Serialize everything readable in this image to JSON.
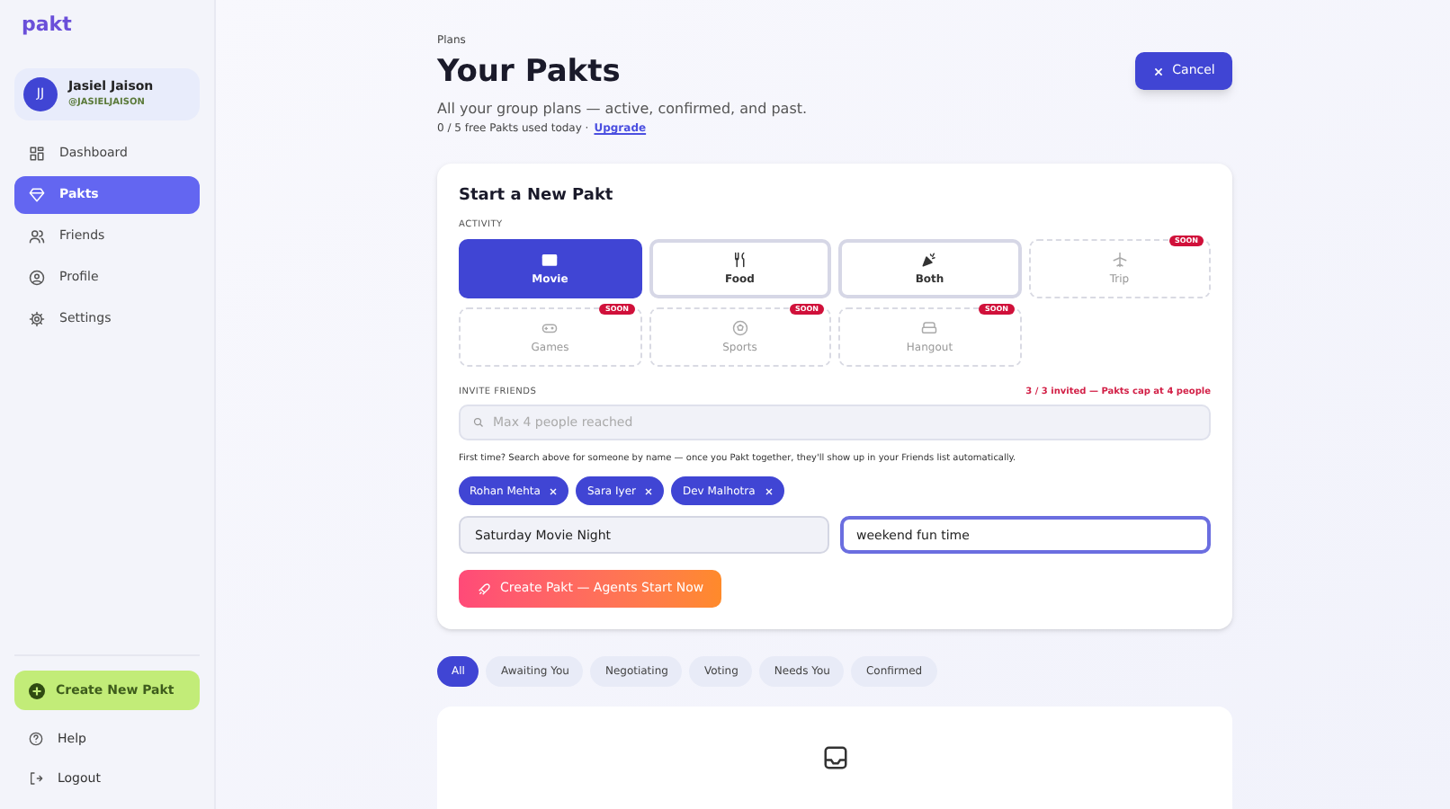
{
  "sidebar": {
    "logo": "pakt",
    "user": {
      "initials": "JJ",
      "name": "Jasiel Jaison",
      "handle": "@JASIELJAISON"
    },
    "items": [
      {
        "label": "Dashboard",
        "selected": false
      },
      {
        "label": "Pakts",
        "selected": true
      },
      {
        "label": "Friends",
        "selected": false
      },
      {
        "label": "Profile",
        "selected": false
      },
      {
        "label": "Settings",
        "selected": false
      }
    ],
    "create_button": "Create New Pakt",
    "footer_items": [
      {
        "label": "Help"
      },
      {
        "label": "Logout"
      }
    ]
  },
  "header": {
    "breadcrumb": "Plans",
    "title": "Your Pakts",
    "subtitle": "All your group plans — active, confirmed, and past.",
    "usage": "0 / 5 free Pakts used today ·",
    "upgrade_link": "Upgrade",
    "cancel_button": "Cancel"
  },
  "new_pakt": {
    "title": "Start a New Pakt",
    "activity_label": "ACTIVITY",
    "activities": [
      {
        "label": "Movie",
        "selected": true,
        "disabled": false
      },
      {
        "label": "Food",
        "selected": false,
        "disabled": false
      },
      {
        "label": "Both",
        "selected": false,
        "disabled": false
      },
      {
        "label": "Trip",
        "selected": false,
        "disabled": true,
        "badge": "SOON"
      },
      {
        "label": "Games",
        "selected": false,
        "disabled": true,
        "badge": "SOON"
      },
      {
        "label": "Sports",
        "selected": false,
        "disabled": true,
        "badge": "SOON"
      },
      {
        "label": "Hangout",
        "selected": false,
        "disabled": true,
        "badge": "SOON"
      }
    ],
    "invite_label": "INVITE FRIENDS",
    "invite_count": "3 / 3 invited — Pakts cap at 4 people",
    "search": {
      "placeholder": "Max 4 people reached",
      "disabled": true
    },
    "hint": "First time? Search above for someone by name — once you Pakt together, they'll show up in your Friends list automatically.",
    "invited": [
      "Rohan Mehta",
      "Sara Iyer",
      "Dev Malhotra"
    ],
    "fields": [
      {
        "value": "Saturday Movie Night",
        "focused": false
      },
      {
        "value": "weekend fun time",
        "focused": true
      }
    ],
    "create_button": "Create Pakt — Agents Start Now"
  },
  "filters": [
    {
      "label": "All",
      "selected": true
    },
    {
      "label": "Awaiting You",
      "selected": false
    },
    {
      "label": "Negotiating",
      "selected": false
    },
    {
      "label": "Voting",
      "selected": false
    },
    {
      "label": "Needs You",
      "selected": false
    },
    {
      "label": "Confirmed",
      "selected": false
    }
  ]
}
